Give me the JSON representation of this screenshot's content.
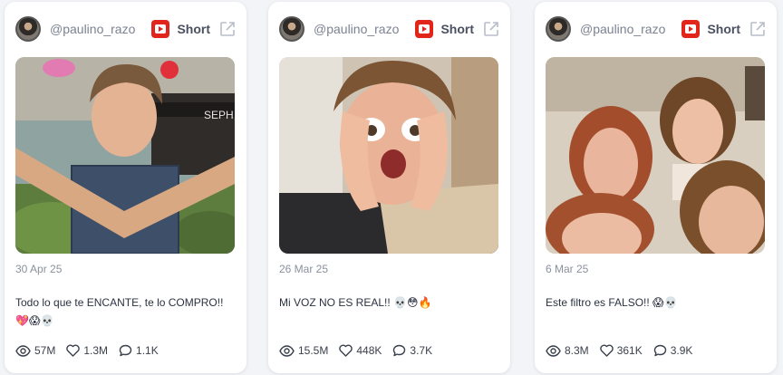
{
  "posts": [
    {
      "handle": "@paulino_razo",
      "type_label": "Short",
      "date": "30 Apr 25",
      "caption": "Todo lo que te ENCANTE, te lo COMPRO!! 💖😱💀",
      "views": "57M",
      "likes": "1.3M",
      "comments": "1.1K"
    },
    {
      "handle": "@paulino_razo",
      "type_label": "Short",
      "date": "26 Mar 25",
      "caption": "Mi VOZ NO ES REAL!! 💀😳🔥",
      "views": "15.5M",
      "likes": "448K",
      "comments": "3.7K"
    },
    {
      "handle": "@paulino_razo",
      "type_label": "Short",
      "date": "6 Mar 25",
      "caption": "Este filtro es FALSO!! 😱💀",
      "views": "8.3M",
      "likes": "361K",
      "comments": "3.9K"
    }
  ],
  "thumb_text": {
    "store_sign": "SEPH"
  },
  "icons": {
    "platform": "youtube-icon",
    "external": "external-link-icon",
    "views": "eye-icon",
    "likes": "heart-icon",
    "comments": "comment-icon"
  },
  "colors": {
    "youtube_red": "#e1251b",
    "card_bg": "#ffffff",
    "page_bg": "#f2f4f7"
  }
}
